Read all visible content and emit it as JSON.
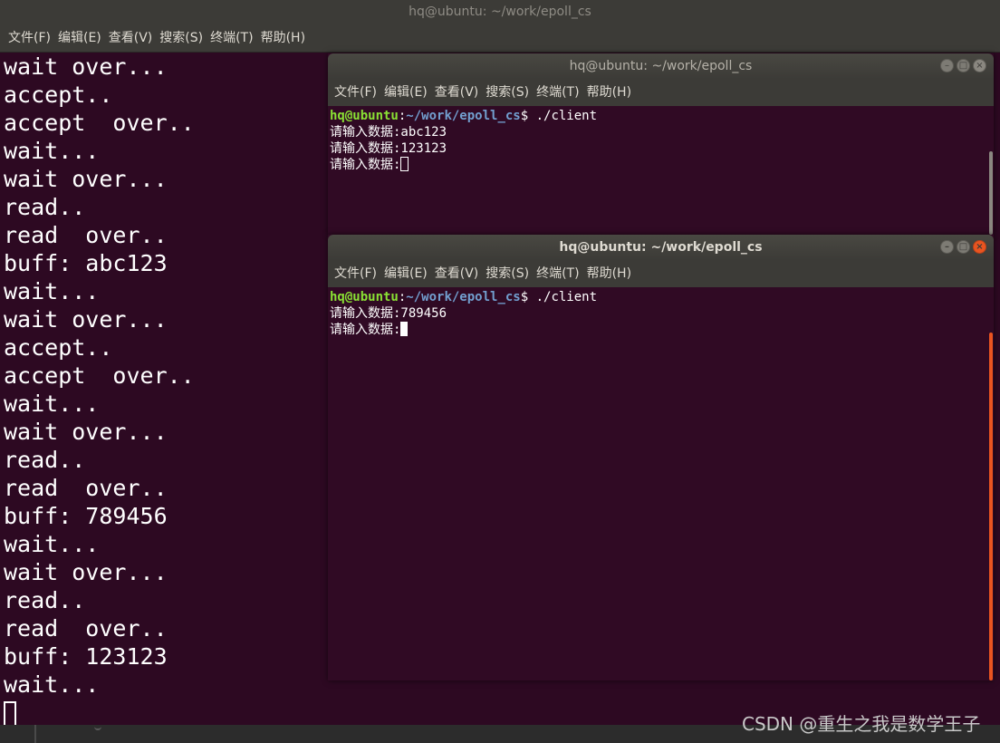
{
  "background_window": {
    "title": "hq@ubuntu: ~/work/epoll_cs",
    "menu": [
      "文件(F)",
      "编辑(E)",
      "查看(V)",
      "搜索(S)",
      "终端(T)",
      "帮助(H)"
    ],
    "output_lines": [
      "wait over...",
      "accept..",
      "accept  over..",
      "wait...",
      "wait over...",
      "read..",
      "read  over..",
      "buff: abc123",
      "wait...",
      "wait over...",
      "accept..",
      "accept  over..",
      "wait...",
      "wait over...",
      "read..",
      "read  over..",
      "buff: 789456",
      "wait...",
      "wait over...",
      "read..",
      "read  over..",
      "buff: 123123",
      "wait..."
    ]
  },
  "client_window_1": {
    "title": "hq@ubuntu: ~/work/epoll_cs",
    "menu": [
      "文件(F)",
      "编辑(E)",
      "查看(V)",
      "搜索(S)",
      "终端(T)",
      "帮助(H)"
    ],
    "prompt_user": "hq@ubuntu",
    "prompt_sep": ":",
    "prompt_path": "~/work/epoll_cs",
    "prompt_end": "$ ",
    "command": "./client",
    "lines": [
      "请输入数据:abc123",
      "请输入数据:123123"
    ],
    "current_prompt": "请输入数据:"
  },
  "client_window_2": {
    "title": "hq@ubuntu: ~/work/epoll_cs",
    "menu": [
      "文件(F)",
      "编辑(E)",
      "查看(V)",
      "搜索(S)",
      "终端(T)",
      "帮助(H)"
    ],
    "prompt_user": "hq@ubuntu",
    "prompt_sep": ":",
    "prompt_path": "~/work/epoll_cs",
    "prompt_end": "$ ",
    "command": "./client",
    "lines": [
      "请输入数据:789456"
    ],
    "current_prompt": "请输入数据:"
  },
  "watermark": "CSDN @重生之我是数学王子",
  "colors": {
    "terminal_bg": "#300a24",
    "titlebar_bg": "#3c3b37",
    "prompt_user": "#8ae234",
    "prompt_path": "#729fcf",
    "close_button": "#e95420"
  }
}
